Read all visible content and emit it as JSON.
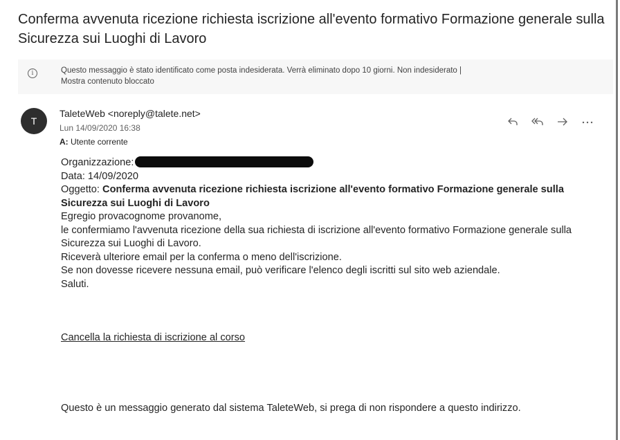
{
  "email": {
    "subject": "Conferma avvenuta ricezione richiesta iscrizione all'evento formativo Formazione generale sulla Sicurezza sui Luoghi di Lavoro",
    "junk_notice": {
      "text": "Questo messaggio è stato identificato come posta indesiderata. Verrà eliminato dopo 10 giorni.",
      "not_junk_link": "Non indesiderato",
      "separator": "|",
      "show_blocked_link": "Mostra contenuto bloccato"
    },
    "sender": {
      "avatar_initial": "T",
      "name_and_address": "TaleteWeb <noreply@talete.net>",
      "date": "Lun 14/09/2020 16:38",
      "to_label": "A:",
      "to_value": "Utente corrente"
    },
    "actions": {
      "reply_icon": "reply-icon",
      "reply_all_icon": "reply-all-icon",
      "forward_icon": "forward-icon",
      "more_icon": "more-options-icon"
    },
    "body": {
      "org_label": "Organizzazione:",
      "data_line": "Data: 14/09/2020",
      "oggetto_label": "Oggetto:",
      "oggetto_value": "Conferma avvenuta ricezione richiesta iscrizione all'evento formativo Formazione generale sulla Sicurezza sui Luoghi di Lavoro",
      "greeting": "Egregio provacognome provanome,",
      "paragraph": "le confermiamo l'avvenuta ricezione della sua richiesta di iscrizione all'evento formativo Formazione generale sulla Sicurezza sui Luoghi di Lavoro.",
      "line_email": "Riceverà ulteriore email per la conferma o meno dell'iscrizione.",
      "line_verify": "Se non dovesse ricevere nessuna email, può verificare l'elenco degli iscritti sul sito web aziendale.",
      "closing": "Saluti."
    },
    "cancel_link": "Cancella la richiesta di iscrizione al corso",
    "footer": "Questo è un messaggio generato dal sistema TaleteWeb, si prega di non rispondere a questo indirizzo."
  }
}
